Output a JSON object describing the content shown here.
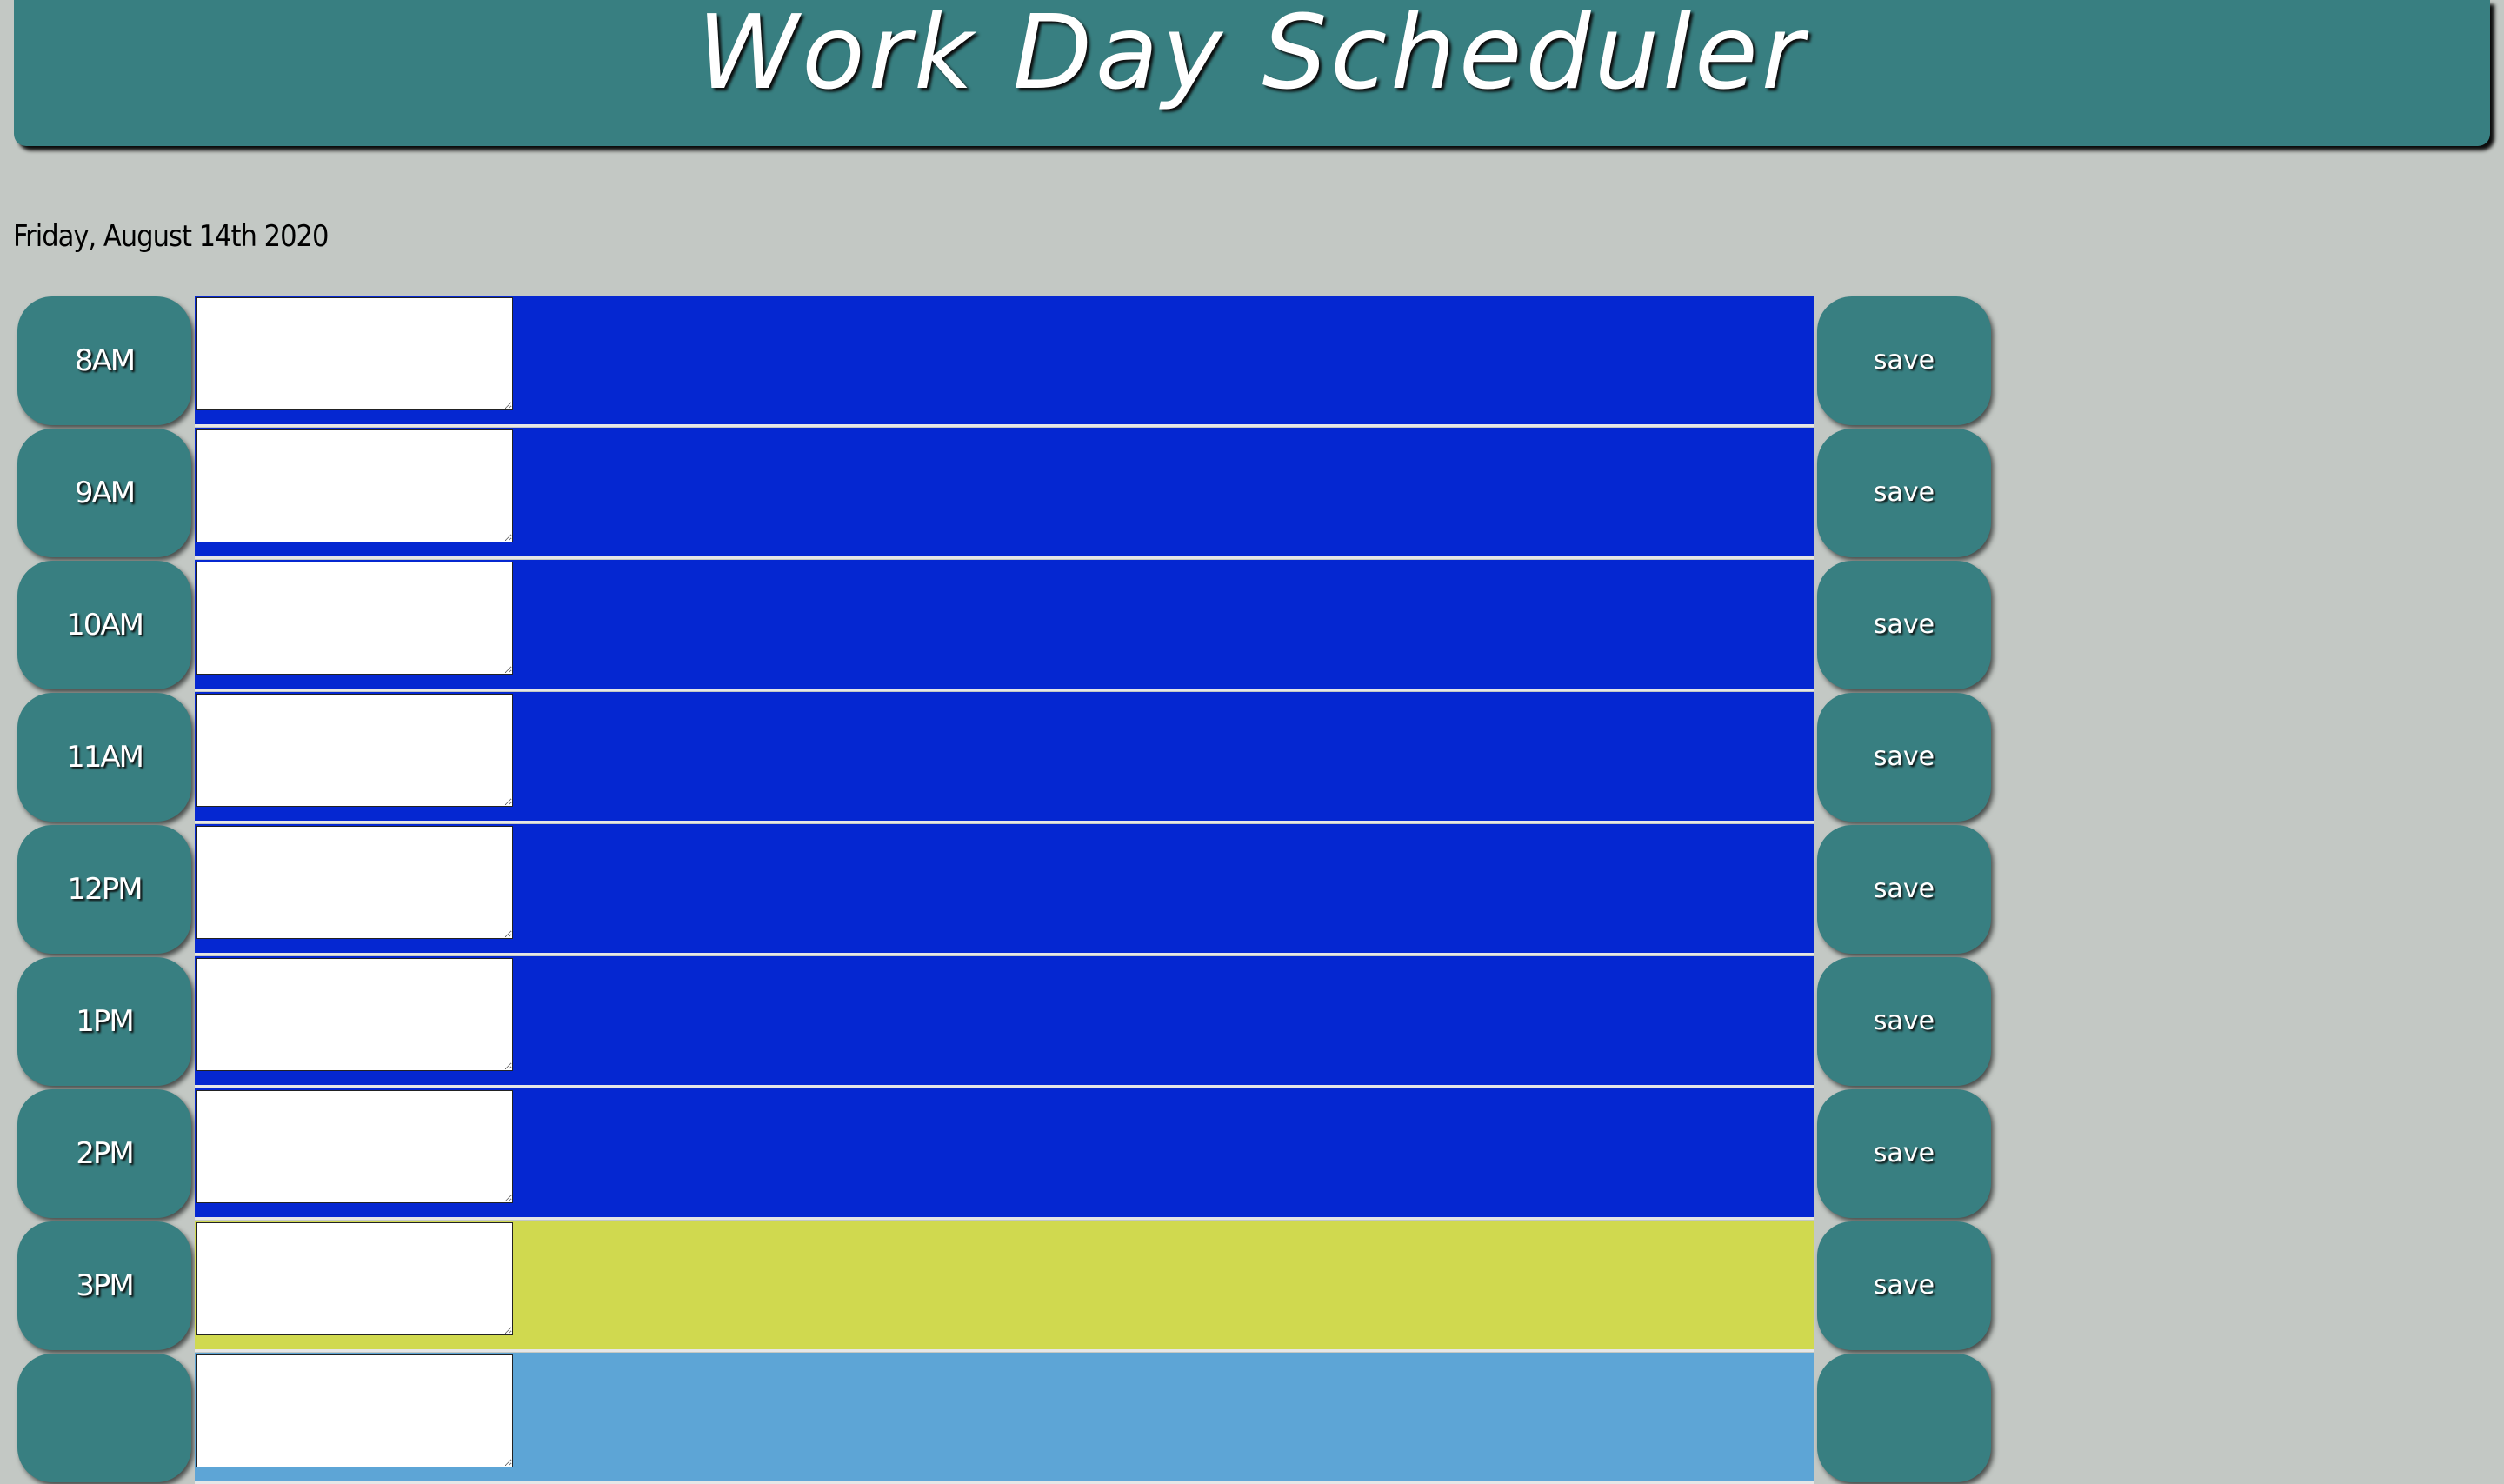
{
  "header": {
    "title": "Work Day Scheduler"
  },
  "current_day": "Friday, August 14th 2020",
  "colors": {
    "header": "#387f81",
    "background": "#c3c8c4",
    "past": "#0527d1",
    "present": "#d0d94f",
    "future": "#5da5d6"
  },
  "rows": [
    {
      "hour": "8AM",
      "status": "past",
      "text": "",
      "save_label": "save"
    },
    {
      "hour": "9AM",
      "status": "past",
      "text": "",
      "save_label": "save"
    },
    {
      "hour": "10AM",
      "status": "past",
      "text": "",
      "save_label": "save"
    },
    {
      "hour": "11AM",
      "status": "past",
      "text": "",
      "save_label": "save"
    },
    {
      "hour": "12PM",
      "status": "past",
      "text": "",
      "save_label": "save"
    },
    {
      "hour": "1PM",
      "status": "past",
      "text": "",
      "save_label": "save"
    },
    {
      "hour": "2PM",
      "status": "past",
      "text": "",
      "save_label": "save"
    },
    {
      "hour": "3PM",
      "status": "present",
      "text": "",
      "save_label": "save"
    },
    {
      "hour": "",
      "status": "future",
      "text": "",
      "save_label": ""
    }
  ]
}
